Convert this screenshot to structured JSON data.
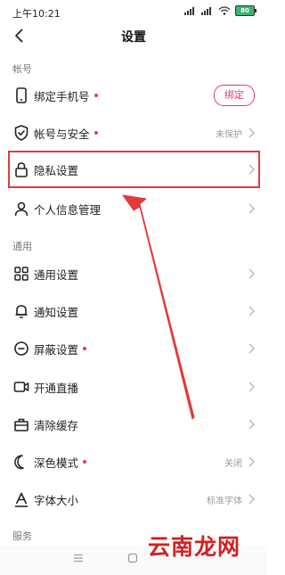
{
  "status_bar": {
    "time": "上午10:21",
    "battery": "80"
  },
  "header": {
    "title": "设置"
  },
  "sections": {
    "account": "帐号",
    "general": "通用",
    "service": "服务"
  },
  "rows": {
    "bind_phone": {
      "label": "绑定手机号",
      "button": "绑定"
    },
    "account_security": {
      "label": "帐号与安全",
      "value": "未保护"
    },
    "privacy": {
      "label": "隐私设置"
    },
    "personal_info": {
      "label": "个人信息管理"
    },
    "general_settings": {
      "label": "通用设置"
    },
    "notification": {
      "label": "通知设置"
    },
    "block": {
      "label": "屏蔽设置"
    },
    "live": {
      "label": "开通直播"
    },
    "cache": {
      "label": "清除缓存"
    },
    "dark_mode": {
      "label": "深色模式",
      "value": "关闭"
    },
    "font_size": {
      "label": "字体大小",
      "value": "标准字体"
    }
  },
  "icons": {
    "back": "back-arrow-icon",
    "phone": "phone-icon",
    "shield": "shield-icon",
    "lock": "lock-icon",
    "person": "person-icon",
    "grid": "grid-icon",
    "bell": "bell-icon",
    "block": "block-icon",
    "camera": "video-camera-icon",
    "box": "box-icon",
    "moon": "moon-icon",
    "font": "font-icon"
  },
  "colors": {
    "accent": "#e8376b",
    "highlight": "#e23b3b"
  },
  "watermark": "云南龙网"
}
